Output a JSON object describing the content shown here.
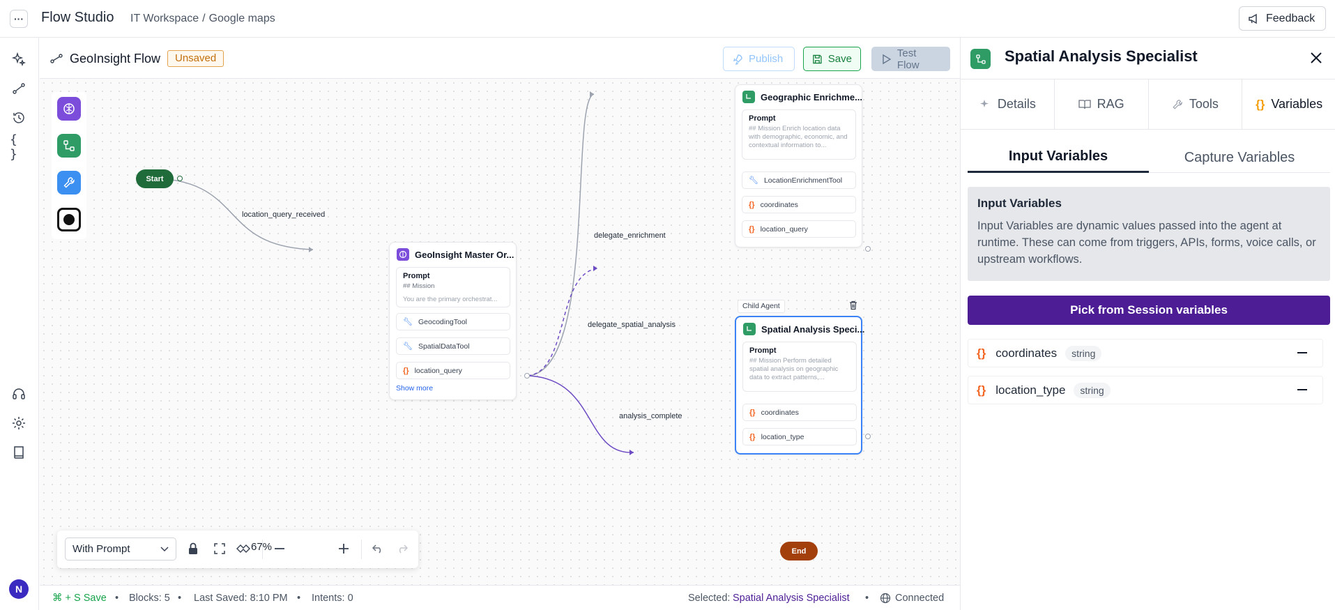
{
  "header": {
    "app_title": "Flow Studio",
    "breadcrumb_workspace": "IT Workspace",
    "breadcrumb_sep": "/",
    "breadcrumb_page": "Google maps",
    "feedback_label": "Feedback"
  },
  "flow": {
    "name": "GeoInsight Flow",
    "status_badge": "Unsaved",
    "publish_label": "Publish",
    "save_label": "Save",
    "test_label": "Test Flow"
  },
  "nodes": {
    "start": "Start",
    "end": "End",
    "master": {
      "title": "GeoInsight Master Or...",
      "prompt_label": "Prompt",
      "prompt_line1": "## Mission",
      "prompt_line2": "You are the primary orchestrat...",
      "tool1": "GeocodingTool",
      "tool2": "SpatialDataTool",
      "var1": "location_query",
      "show_more": "Show more"
    },
    "geo": {
      "title": "Geographic Enrichme...",
      "prompt_label": "Prompt",
      "prompt_text": "## Mission Enrich location data with demographic, economic, and contextual information to...",
      "tool1": "LocationEnrichmentTool",
      "var1": "coordinates",
      "var2": "location_query"
    },
    "spatial": {
      "badge": "Child Agent",
      "title": "Spatial Analysis Speci...",
      "prompt_label": "Prompt",
      "prompt_text": "## Mission Perform detailed spatial analysis on geographic data to extract patterns,...",
      "var1": "coordinates",
      "var2": "location_type"
    }
  },
  "edges": {
    "e1": "location_query_received",
    "e2": "delegate_enrichment",
    "e3": "delegate_spatial_analysis",
    "e4": "analysis_complete"
  },
  "toolbar": {
    "mode": "With Prompt",
    "zoom": "67%"
  },
  "status": {
    "shortcut": "⌘ + S Save",
    "blocks": "Blocks: 5",
    "last_saved": "Last Saved: 8:10 PM",
    "intents": "Intents: 0",
    "selected_label": "Selected:",
    "selected_value": "Spatial Analysis Specialist",
    "connection": "Connected",
    "dot": "•"
  },
  "panel": {
    "title": "Spatial Analysis Specialist",
    "tabs": [
      "Details",
      "RAG",
      "Tools",
      "Variables"
    ],
    "subtabs": [
      "Input Variables",
      "Capture Variables"
    ],
    "info_title": "Input Variables",
    "info_text": "Input Variables are dynamic values passed into the agent at runtime. These can come from triggers, APIs, forms, voice calls, or upstream workflows.",
    "pick_label": "Pick from Session variables",
    "variables": [
      {
        "icon": "{}",
        "name": "coordinates",
        "type": "string"
      },
      {
        "icon": "{}",
        "name": "location_type",
        "type": "string"
      }
    ]
  },
  "colors": {
    "accent_purple": "#4c1d95",
    "edge_purple": "#6d4bc4",
    "start_green": "#1f6b3a",
    "end_orange": "#a33f0b",
    "selected_blue": "#3b82f6",
    "var_icon": "#f26522"
  }
}
